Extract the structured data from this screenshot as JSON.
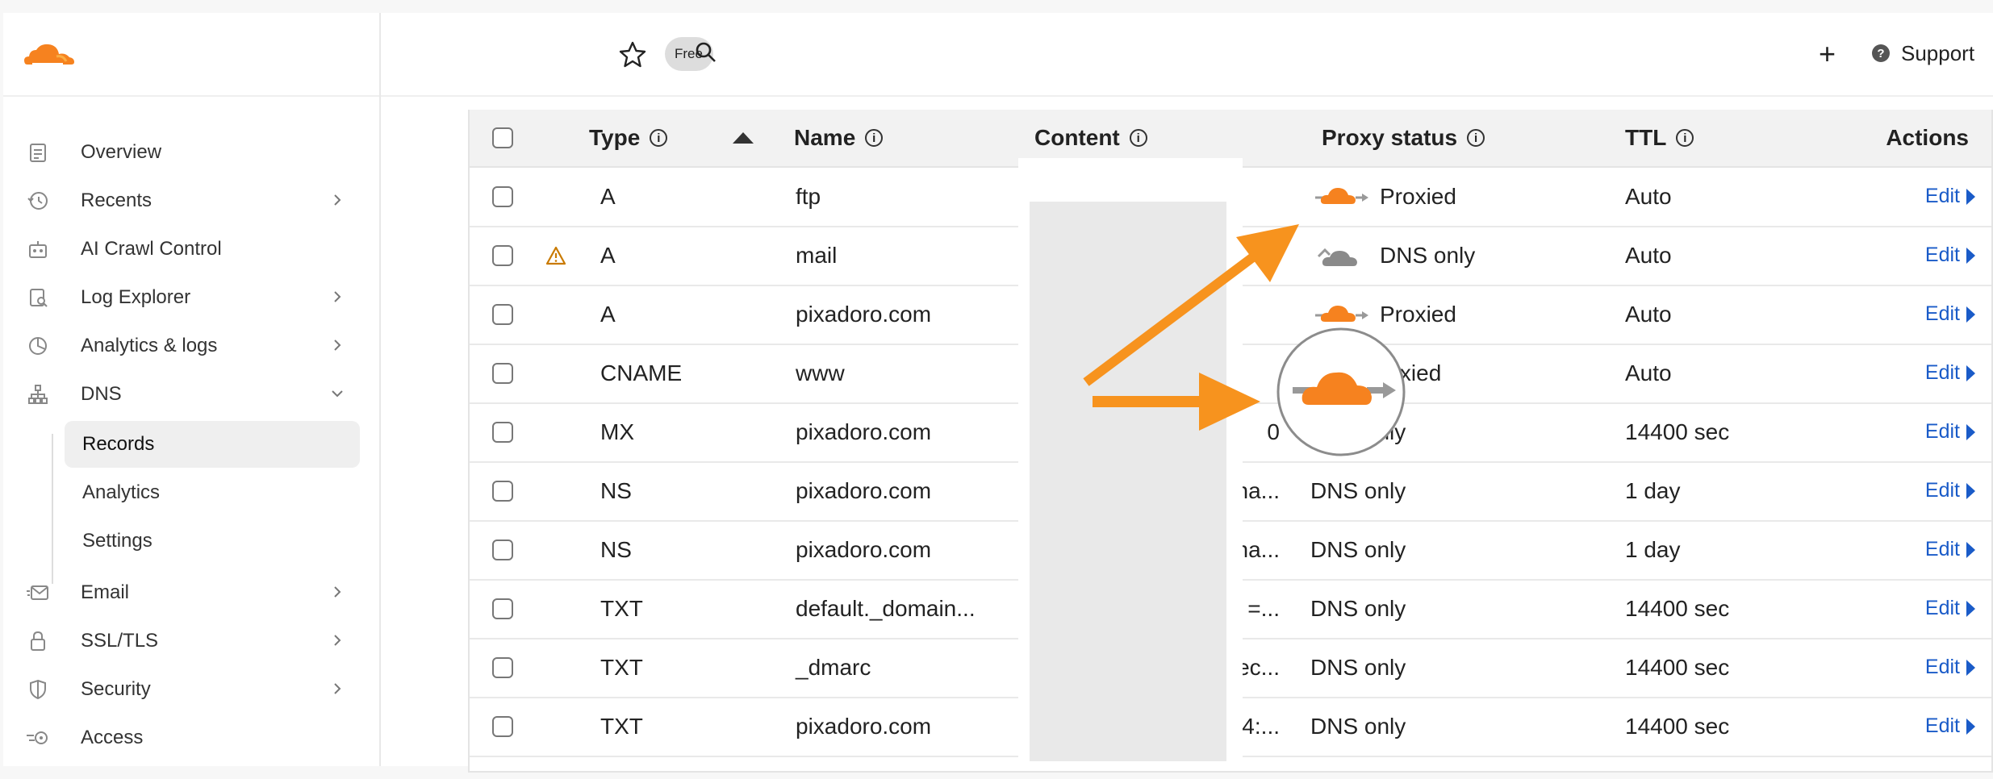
{
  "header": {
    "free_label": "Free",
    "plus_label": "+",
    "support_label": "Support",
    "support_icon_glyph": "?"
  },
  "sidebar": {
    "items": [
      {
        "label": "Overview",
        "icon": "clipboard-icon",
        "chevron": false
      },
      {
        "label": "Recents",
        "icon": "history-icon",
        "chevron": true
      },
      {
        "label": "AI Crawl Control",
        "icon": "robot-icon",
        "chevron": false
      },
      {
        "label": "Log Explorer",
        "icon": "log-icon",
        "chevron": true
      },
      {
        "label": "Analytics & logs",
        "icon": "pie-chart-icon",
        "chevron": true
      },
      {
        "label": "DNS",
        "icon": "network-icon",
        "chevron": "down"
      }
    ],
    "dns_sub": [
      {
        "label": "Records",
        "active": true
      },
      {
        "label": "Analytics",
        "active": false
      },
      {
        "label": "Settings",
        "active": false
      }
    ],
    "more_items": [
      {
        "label": "Email",
        "icon": "email-icon",
        "chevron": true
      },
      {
        "label": "SSL/TLS",
        "icon": "lock-icon",
        "chevron": true
      },
      {
        "label": "Security",
        "icon": "shield-icon",
        "chevron": true
      },
      {
        "label": "Access",
        "icon": "access-icon",
        "chevron": false
      }
    ]
  },
  "table": {
    "columns": {
      "type": "Type",
      "name": "Name",
      "content": "Content",
      "proxy": "Proxy status",
      "ttl": "TTL",
      "actions": "Actions"
    },
    "info_glyph": "i",
    "edit_label": "Edit",
    "rows": [
      {
        "type": "A",
        "name": "ftp",
        "content": "",
        "proxy": "Proxied",
        "ttl": "Auto",
        "warning": false
      },
      {
        "type": "A",
        "name": "mail",
        "content": "",
        "proxy": "DNS only",
        "ttl": "Auto",
        "warning": true
      },
      {
        "type": "A",
        "name": "pixadoro.com",
        "content": "",
        "proxy": "Proxied",
        "ttl": "Auto",
        "warning": false
      },
      {
        "type": "CNAME",
        "name": "www",
        "content": "",
        "proxy": "roxied",
        "ttl": "Auto",
        "warning": false
      },
      {
        "type": "MX",
        "name": "pixadoro.com",
        "content": "0",
        "proxy": "DNS only",
        "ttl": "14400 sec",
        "warning": false
      },
      {
        "type": "NS",
        "name": "pixadoro.com",
        "content": "na...",
        "proxy": "DNS only",
        "ttl": "1 day",
        "warning": false
      },
      {
        "type": "NS",
        "name": "pixadoro.com",
        "content": "na...",
        "proxy": "DNS only",
        "ttl": "1 day",
        "warning": false
      },
      {
        "type": "TXT",
        "name": "default._domain...",
        "content": "=...",
        "proxy": "DNS only",
        "ttl": "14400 sec",
        "warning": false
      },
      {
        "type": "TXT",
        "name": "_dmarc",
        "content": "ec...",
        "proxy": "DNS only",
        "ttl": "14400 sec",
        "warning": false
      },
      {
        "type": "TXT",
        "name": "pixadoro.com",
        "content": "o4:...",
        "proxy": "DNS only",
        "ttl": "14400 sec",
        "warning": false
      }
    ]
  },
  "colors": {
    "accent": "#f6821f",
    "link": "#1a5bc8",
    "arrow": "#f7931e",
    "gray_cloud": "#8a8a8a"
  }
}
